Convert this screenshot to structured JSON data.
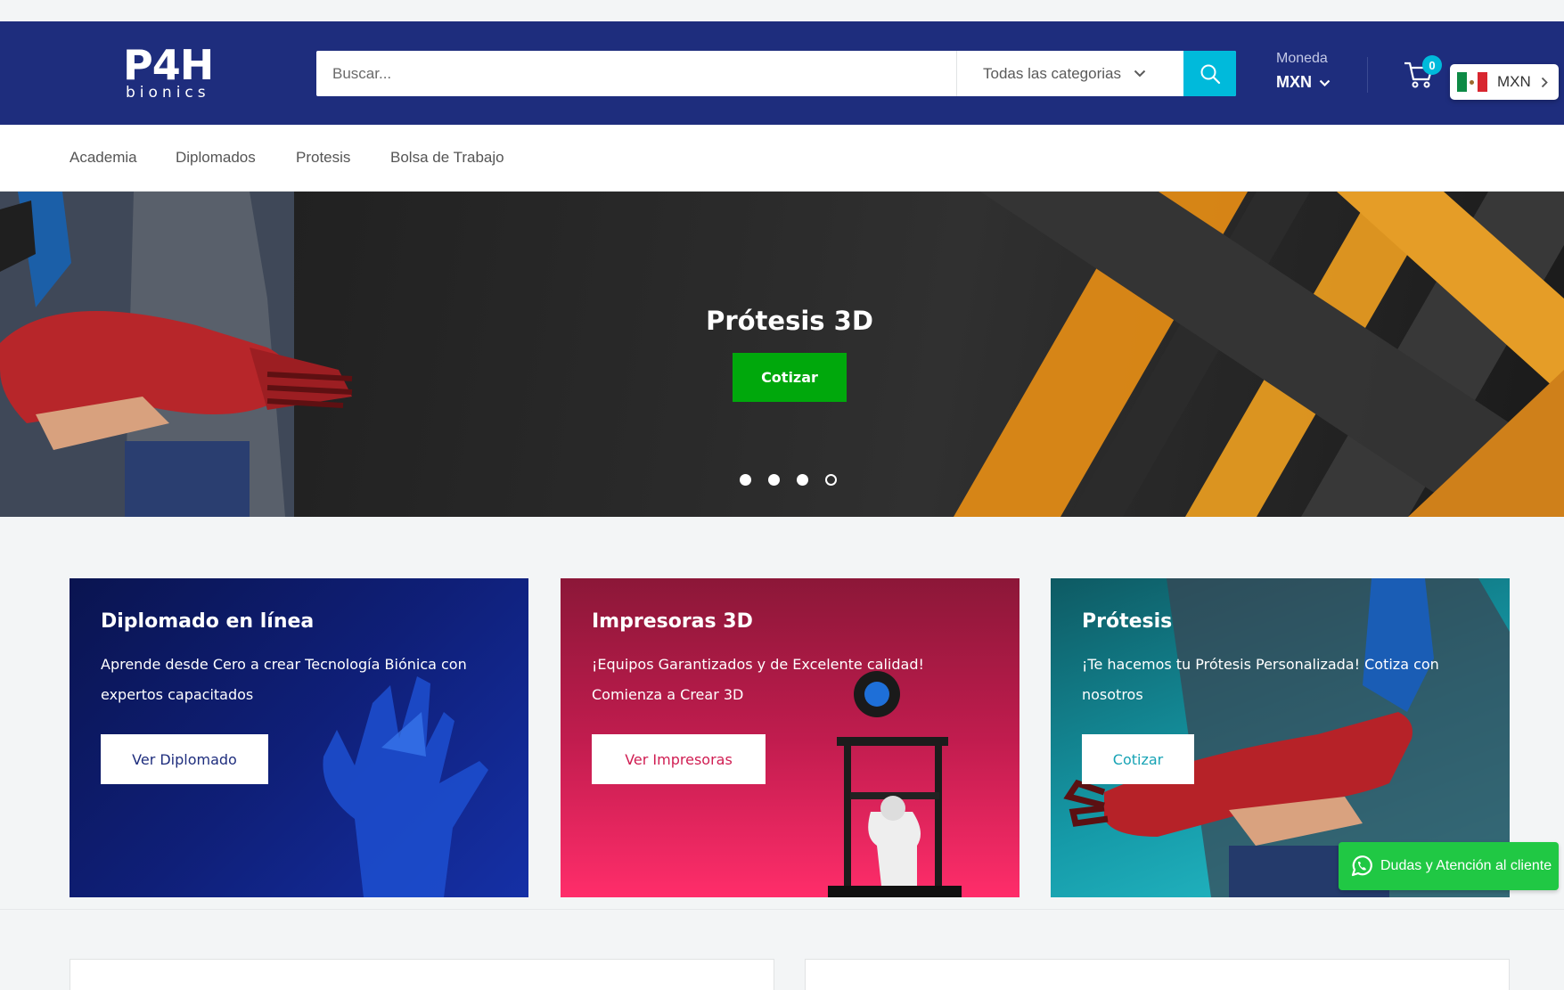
{
  "header": {
    "logo_mark": "P4H",
    "logo_sub": "bionics",
    "search": {
      "placeholder": "Buscar...",
      "category_label": "Todas las categorias"
    },
    "currency": {
      "label": "Moneda",
      "value": "MXN"
    },
    "cart_count": "0",
    "currency_popup": {
      "value": "MXN",
      "flag": "mexico-flag"
    }
  },
  "nav": {
    "items": [
      {
        "label": "Academia"
      },
      {
        "label": "Diplomados"
      },
      {
        "label": "Protesis"
      },
      {
        "label": "Bolsa de Trabajo"
      }
    ]
  },
  "hero": {
    "title": "Prótesis 3D",
    "button_label": "Cotizar",
    "slides": 4,
    "active_slide": 4
  },
  "cards": [
    {
      "title": "Diplomado en línea",
      "text": "Aprende desde Cero a crear Tecnología Biónica con expertos capacitados",
      "button_label": "Ver Diplomado"
    },
    {
      "title": "Impresoras 3D",
      "text": "¡Equipos Garantizados y de Excelente calidad! Comienza a Crear 3D",
      "button_label": "Ver Impresoras"
    },
    {
      "title": "Prótesis",
      "text": "¡Te hacemos tu Prótesis Personalizada! Cotiza con nosotros",
      "button_label": "Cotizar"
    }
  ],
  "whatsapp": {
    "label": "Dudas y Atención al cliente"
  },
  "colors": {
    "header_bg": "#1e2d7d",
    "accent": "#00badb",
    "hero_button": "#00a80c",
    "whatsapp": "#20c844"
  }
}
